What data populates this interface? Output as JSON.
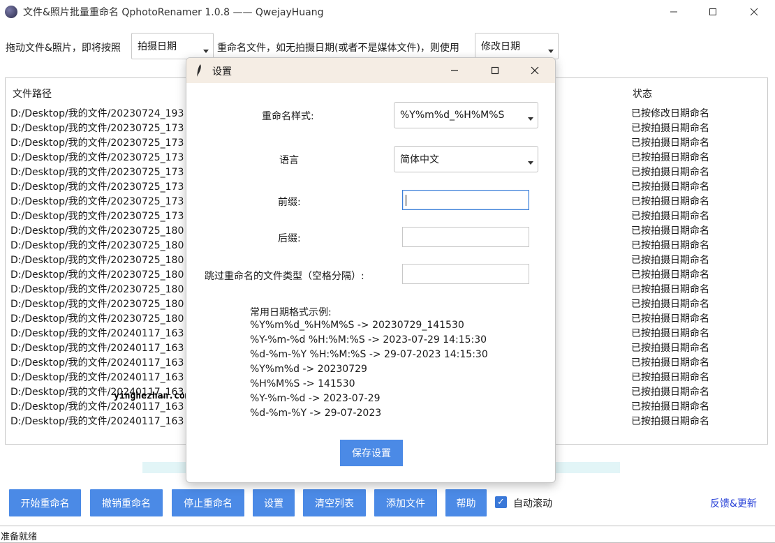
{
  "window": {
    "title": "文件&照片批量重命名 QphotoRenamer 1.0.8 —— QwejayHuang"
  },
  "topbar": {
    "text_before": "拖动文件&照片，即将按照",
    "primary_rule": "拍摄日期",
    "text_middle": "重命名文件，如无拍摄日期(或者不是媒体文件)，则使用",
    "fallback_rule": "修改日期"
  },
  "list": {
    "headers": {
      "path": "文件路径",
      "status": "状态"
    },
    "rows": [
      {
        "path": "D:/Desktop/我的文件/20230724_193",
        "status": "已按修改日期命名"
      },
      {
        "path": "D:/Desktop/我的文件/20230725_173",
        "status": "已按拍摄日期命名"
      },
      {
        "path": "D:/Desktop/我的文件/20230725_173",
        "status": "已按拍摄日期命名"
      },
      {
        "path": "D:/Desktop/我的文件/20230725_173",
        "status": "已按拍摄日期命名"
      },
      {
        "path": "D:/Desktop/我的文件/20230725_173",
        "status": "已按拍摄日期命名"
      },
      {
        "path": "D:/Desktop/我的文件/20230725_173",
        "status": "已按拍摄日期命名"
      },
      {
        "path": "D:/Desktop/我的文件/20230725_173",
        "status": "已按拍摄日期命名"
      },
      {
        "path": "D:/Desktop/我的文件/20230725_173",
        "status": "已按拍摄日期命名"
      },
      {
        "path": "D:/Desktop/我的文件/20230725_180",
        "status": "已按拍摄日期命名"
      },
      {
        "path": "D:/Desktop/我的文件/20230725_180",
        "status": "已按拍摄日期命名"
      },
      {
        "path": "D:/Desktop/我的文件/20230725_180",
        "status": "已按拍摄日期命名"
      },
      {
        "path": "D:/Desktop/我的文件/20230725_180",
        "status": "已按拍摄日期命名"
      },
      {
        "path": "D:/Desktop/我的文件/20230725_180",
        "status": "已按拍摄日期命名"
      },
      {
        "path": "D:/Desktop/我的文件/20230725_180",
        "status": "已按拍摄日期命名"
      },
      {
        "path": "D:/Desktop/我的文件/20230725_180",
        "status": "已按拍摄日期命名"
      },
      {
        "path": "D:/Desktop/我的文件/20240117_163",
        "status": "已按拍摄日期命名"
      },
      {
        "path": "D:/Desktop/我的文件/20240117_163",
        "status": "已按拍摄日期命名"
      },
      {
        "path": "D:/Desktop/我的文件/20240117_163",
        "status": "已按拍摄日期命名"
      },
      {
        "path": "D:/Desktop/我的文件/20240117_163",
        "status": "已按拍摄日期命名"
      },
      {
        "path": "D:/Desktop/我的文件/20240117_163",
        "status": "已按拍摄日期命名"
      },
      {
        "path": "D:/Desktop/我的文件/20240117_163",
        "status": "已按拍摄日期命名"
      },
      {
        "path": "D:/Desktop/我的文件/20240117_163",
        "status": "已按拍摄日期命名"
      }
    ]
  },
  "watermark": "yinghezhan.com",
  "buttons": {
    "start": "开始重命名",
    "undo": "撤销重命名",
    "stop": "停止重命名",
    "settings": "设置",
    "clear": "清空列表",
    "add": "添加文件",
    "help": "帮助"
  },
  "auto_scroll": {
    "label": "自动滚动",
    "checked": true,
    "check_glyph": "✓"
  },
  "feedback_link": "反馈&更新",
  "status_text": "准备就绪",
  "dialog": {
    "title": "设置",
    "rename_style_label": "重命名样式:",
    "rename_style_value": "%Y%m%d_%H%M%S",
    "language_label": "语言",
    "language_value": "简体中文",
    "prefix_label": "前缀:",
    "prefix_value": "",
    "suffix_label": "后缀:",
    "suffix_value": "",
    "skip_label": "跳过重命名的文件类型（空格分隔）:",
    "skip_value": "",
    "examples_title": "常用日期格式示例:",
    "examples": [
      "%Y%m%d_%H%M%S -> 20230729_141530",
      "%Y-%m-%d %H:%M:%S -> 2023-07-29 14:15:30",
      "%d-%m-%Y %H:%M:%S -> 29-07-2023 14:15:30",
      "%Y%m%d -> 20230729",
      "%H%M%S -> 141530",
      "%Y-%m-%d -> 2023-07-29",
      "%d-%m-%Y -> 29-07-2023"
    ],
    "save_label": "保存设置"
  },
  "colors": {
    "accent": "#4b8ae6",
    "link": "#2a43d8",
    "dialog_title_bg": "#f5ede4"
  }
}
